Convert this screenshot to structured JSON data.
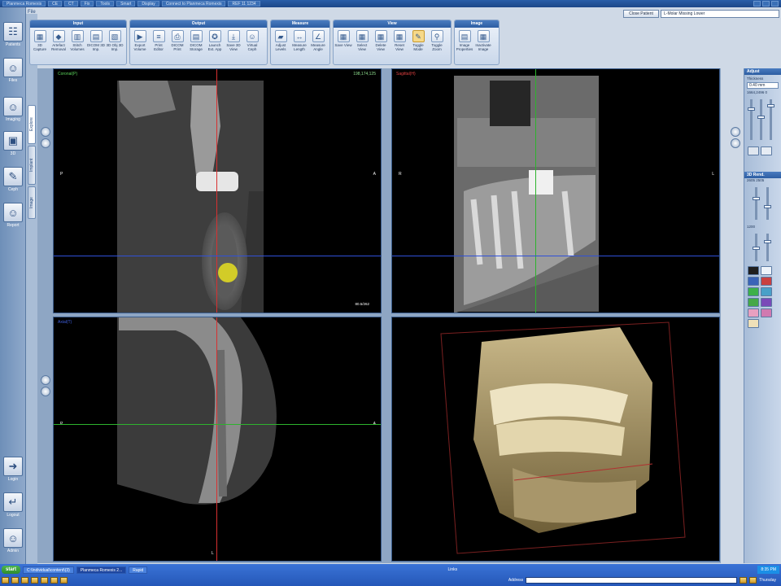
{
  "titlebar": {
    "items": [
      "Planmeca Romexis",
      "CE",
      "CT",
      "Fix",
      "Tools",
      "Smart",
      "Display",
      "Connect to Planmeca Romexis",
      "REF 11 1234"
    ]
  },
  "menu_label": "File",
  "nav": [
    {
      "label": "Patients",
      "icon": "patients-icon",
      "glyph": "☷"
    },
    {
      "label": "Files",
      "icon": "files-icon",
      "glyph": "☺"
    },
    {
      "label": "Imaging",
      "icon": "imaging-icon",
      "glyph": "☺"
    },
    {
      "label": "3D",
      "icon": "3d-icon",
      "glyph": "▣"
    },
    {
      "label": "Ceph",
      "icon": "ceph-icon",
      "glyph": "✎"
    },
    {
      "label": "Report",
      "icon": "report-icon",
      "glyph": "☺"
    }
  ],
  "nav_bottom": [
    {
      "label": "Login",
      "icon": "login-icon",
      "glyph": "➜"
    },
    {
      "label": "Logout",
      "icon": "logout-icon",
      "glyph": "↵"
    },
    {
      "label": "Admin",
      "icon": "admin-icon",
      "glyph": "☺"
    }
  ],
  "vtabs": [
    "Explore",
    "Implant",
    "Image"
  ],
  "ribbon": [
    {
      "title": "Input",
      "buttons": [
        {
          "label": "3D Capture",
          "glyph": "▦"
        },
        {
          "label": "Artefact Removal",
          "glyph": "◆"
        },
        {
          "label": "Stitch Volumes",
          "glyph": "▥"
        },
        {
          "label": "DICOM 3D Imp.",
          "glyph": "▤"
        },
        {
          "label": "3D Obj 3D Imp.",
          "glyph": "▧"
        }
      ]
    },
    {
      "title": "Output",
      "buttons": [
        {
          "label": "Export Volume",
          "glyph": "▶"
        },
        {
          "label": "Print Editor",
          "glyph": "≡"
        },
        {
          "label": "DICOM Print",
          "glyph": "⎙"
        },
        {
          "label": "DICOM Storage",
          "glyph": "▤"
        },
        {
          "label": "Launch Ext. App",
          "glyph": "✪"
        },
        {
          "label": "Save 3D View",
          "glyph": "⤓"
        },
        {
          "label": "Virtual Ceph",
          "glyph": "☺"
        }
      ]
    },
    {
      "title": "Measure",
      "buttons": [
        {
          "label": "Adjust Levels",
          "glyph": "▰"
        },
        {
          "label": "Measure Length",
          "glyph": "↔"
        },
        {
          "label": "Measure Angle",
          "glyph": "∠"
        }
      ]
    },
    {
      "title": "View",
      "buttons": [
        {
          "label": "Save View",
          "glyph": "▦"
        },
        {
          "label": "Select View",
          "glyph": "▦"
        },
        {
          "label": "Delete View",
          "glyph": "▦"
        },
        {
          "label": "Reset View",
          "glyph": "▦"
        },
        {
          "label": "Toggle Mode",
          "glyph": "✎",
          "selected": true
        },
        {
          "label": "Toggle Zoom",
          "glyph": "⚲"
        }
      ]
    },
    {
      "title": "Image",
      "buttons": [
        {
          "label": "Image Properties",
          "glyph": "▤"
        },
        {
          "label": "Inactivate Image",
          "glyph": "▦"
        }
      ]
    }
  ],
  "close_patient": "Close Patient",
  "patient_name": "L-Molar Missing Lower",
  "viewports": {
    "coronal": {
      "title": "Coronal(P)",
      "info": "198,174,125",
      "zoom": "80.5/262",
      "label_left": "P",
      "label_right": "A"
    },
    "sagittal": {
      "title": "Sagittal(H)",
      "label_left": "R",
      "label_right": "L"
    },
    "axial": {
      "title": "Axial(T)",
      "label_left": "P",
      "label_right": "A",
      "label_bottom": "L"
    },
    "volume": {
      "title": ""
    }
  },
  "rightpanel": {
    "adjust": {
      "title": "Adjust",
      "thickness_label": "Thickness",
      "thickness_value": "0.40 mm",
      "window_label": "1664,2496",
      "window_extra": "0"
    },
    "render": {
      "title": "3D Rend.",
      "values_label": "2605 2505",
      "value2": "1200"
    }
  },
  "taskbar": {
    "start": "start",
    "tasks": [
      {
        "label": "C:\\Individual\\content\\(3)",
        "active": false
      },
      {
        "label": "Planmeca Romexis 2...",
        "active": true
      },
      {
        "label": "Rapid",
        "active": false
      }
    ],
    "links_label": "Links",
    "address_label": "Address",
    "clock": "8:35 PM",
    "day": "Thursday"
  }
}
